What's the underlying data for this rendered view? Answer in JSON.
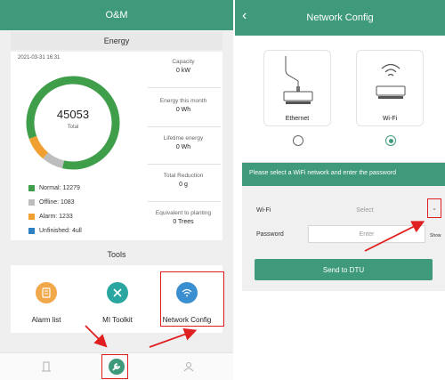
{
  "left": {
    "header_title": "O&M",
    "energy_section": "Energy",
    "date": "2021-03-31 16:31",
    "donut": {
      "total": "45053",
      "total_label": "Total"
    },
    "legend": [
      {
        "label": "Normal: 12279",
        "color": "#3f9e4a"
      },
      {
        "label": "Offline: 1083",
        "color": "#bdbdbd"
      },
      {
        "label": "Alarm: 1233",
        "color": "#f0a030"
      },
      {
        "label": "Unfinished: 4ull",
        "color": "#2f80c0"
      }
    ],
    "stats": [
      {
        "label": "Capacity",
        "value": "0 kW"
      },
      {
        "label": "Energy this month",
        "value": "0 Wh"
      },
      {
        "label": "Lifetime energy",
        "value": "0 Wh"
      },
      {
        "label": "Total Reduction",
        "value": "0 g"
      },
      {
        "label": "Equivalent to planting",
        "value": "0 Trees"
      }
    ],
    "tools_section": "Tools",
    "tools": [
      {
        "label": "Alarm list",
        "color": "#f0a84a",
        "icon": "list-icon"
      },
      {
        "label": "MI Toolkit",
        "color": "#2aa6a0",
        "icon": "wrench-screwdriver-icon"
      },
      {
        "label": "Network Config",
        "color": "#3a8fd0",
        "icon": "network-icon"
      }
    ],
    "tabbar": [
      {
        "name": "plant-tab",
        "icon": "building-icon"
      },
      {
        "name": "tools-tab",
        "icon": "wrench-icon"
      },
      {
        "name": "account-tab",
        "icon": "user-icon"
      }
    ]
  },
  "right": {
    "header_title": "Network Config",
    "back_icon": "chevron-left-icon",
    "options": [
      {
        "label": "Ethernet",
        "selected": false
      },
      {
        "label": "Wi-Fi",
        "selected": true
      }
    ],
    "banner_text": "Please select a WiFi network and enter the password",
    "wifi_label": "Wi-Fi",
    "wifi_value": "Select",
    "password_label": "Password",
    "password_placeholder": "Enter",
    "password_toggle": "Show",
    "send_button": "Send to DTU"
  },
  "colors": {
    "brand": "#3f9a7b",
    "highlight": "#e02020"
  }
}
